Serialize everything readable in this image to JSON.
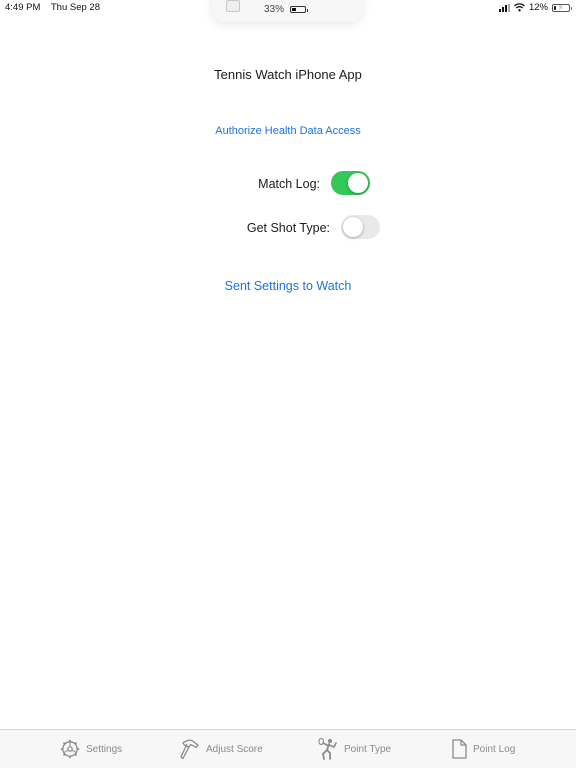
{
  "status_bar": {
    "time": "4:49 PM",
    "date": "Thu Sep 28",
    "battery_percent": "12%",
    "battery_level": 0.12,
    "charging": true
  },
  "watch_widget": {
    "battery_percent": "33%",
    "battery_level": 0.33
  },
  "main": {
    "title": "Tennis Watch iPhone App",
    "authorize_link": "Authorize Health Data Access",
    "send_settings_link": "Sent Settings to Watch",
    "settings": [
      {
        "label": "Match Log:",
        "on": true
      },
      {
        "label": "Get Shot Type:",
        "on": false
      }
    ]
  },
  "colors": {
    "accent": "#1a73e8",
    "toggle_on": "#34c759",
    "toggle_off": "#e9e9eb",
    "tab_icon": "#8a8a8e"
  },
  "tab_bar": {
    "tabs": [
      {
        "label": "Settings",
        "icon": "gear-icon"
      },
      {
        "label": "Adjust Score",
        "icon": "hammer-icon"
      },
      {
        "label": "Point Type",
        "icon": "tennis-player-icon"
      },
      {
        "label": "Point Log",
        "icon": "document-icon"
      }
    ]
  }
}
